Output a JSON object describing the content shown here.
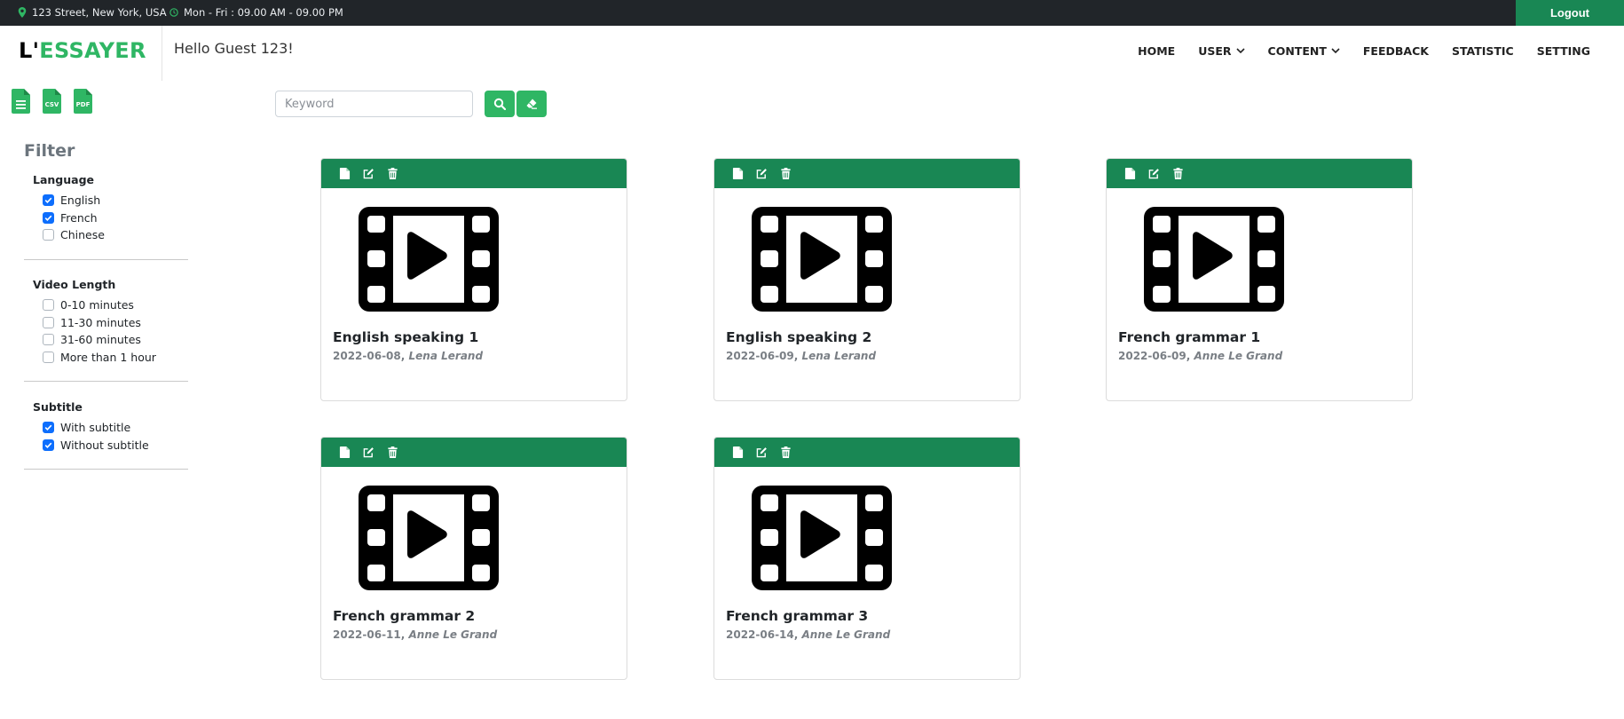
{
  "topbar": {
    "address": "123 Street, New York, USA",
    "hours": "Mon - Fri : 09.00 AM - 09.00 PM",
    "logout_label": "Logout"
  },
  "header": {
    "logo_prefix": "L'",
    "logo_main": "ESSAYER",
    "greeting": "Hello Guest 123!",
    "nav": [
      "HOME",
      "USER",
      "CONTENT",
      "FEEDBACK",
      "STATISTIC",
      "SETTING"
    ]
  },
  "exports": [
    "txt-file-icon",
    "csv-file-icon",
    "pdf-file-icon"
  ],
  "search": {
    "placeholder": "Keyword",
    "value": ""
  },
  "filter": {
    "title": "Filter",
    "groups": [
      {
        "title": "Language",
        "options": [
          {
            "label": "English",
            "checked": true
          },
          {
            "label": "French",
            "checked": true
          },
          {
            "label": "Chinese",
            "checked": false
          }
        ]
      },
      {
        "title": "Video Length",
        "options": [
          {
            "label": "0-10 minutes",
            "checked": false
          },
          {
            "label": "11-30 minutes",
            "checked": false
          },
          {
            "label": "31-60 minutes",
            "checked": false
          },
          {
            "label": "More than 1 hour",
            "checked": false
          }
        ]
      },
      {
        "title": "Subtitle",
        "options": [
          {
            "label": "With subtitle",
            "checked": true
          },
          {
            "label": "Without subtitle",
            "checked": true
          }
        ]
      }
    ]
  },
  "cards": [
    {
      "title": "English speaking 1",
      "date": "2022-06-08,",
      "author": "Lena Lerand"
    },
    {
      "title": "English speaking 2",
      "date": "2022-06-09,",
      "author": "Lena Lerand"
    },
    {
      "title": "French grammar 1",
      "date": "2022-06-09,",
      "author": "Anne Le Grand"
    },
    {
      "title": "French grammar 2",
      "date": "2022-06-11,",
      "author": "Anne Le Grand"
    },
    {
      "title": "French grammar 3",
      "date": "2022-06-14,",
      "author": "Anne Le Grand"
    }
  ],
  "colors": {
    "primary_green": "#198754",
    "light_green": "#2fb664",
    "topbar_bg": "#212529",
    "checkbox_blue": "#0d6efd"
  }
}
